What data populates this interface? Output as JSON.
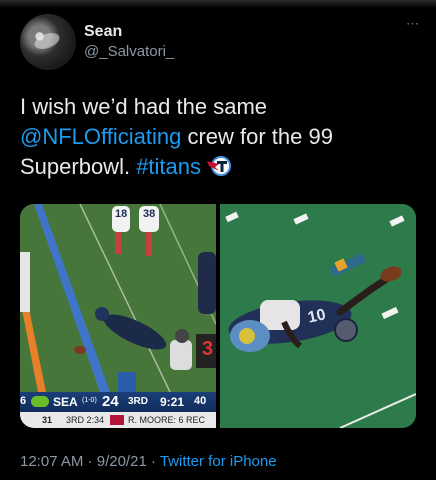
{
  "author": {
    "name": "Sean",
    "handle": "@_Salvatori_"
  },
  "more_icon": "⋯",
  "tweet": {
    "text_1": "I wish we’d had the same ",
    "mention": "@NFLOfficiating",
    "text_2": " crew for the 99 Superbowl. ",
    "hashtag": "#titans"
  },
  "media": {
    "left_scoreboard": {
      "quarter_left": "6",
      "team": "SEA",
      "record": "(1-0)",
      "score": "24",
      "down": "3RD",
      "clock": "9:21",
      "play_clock": "40",
      "sub_left": "31",
      "sub_mid": "3RD 2:34",
      "sub_right": "R. MOORE: 6 REC"
    },
    "left_jersey_a": "18",
    "left_jersey_b": "38",
    "down_marker": "3",
    "right_jersey": "10"
  },
  "footer": {
    "time": "12:07 AM",
    "sep1": " · ",
    "date": "9/20/21",
    "sep2": " · ",
    "source": "Twitter for iPhone"
  },
  "colors": {
    "link": "#1d9bf0",
    "muted": "#8b98a5",
    "text": "#e7e9ea"
  }
}
